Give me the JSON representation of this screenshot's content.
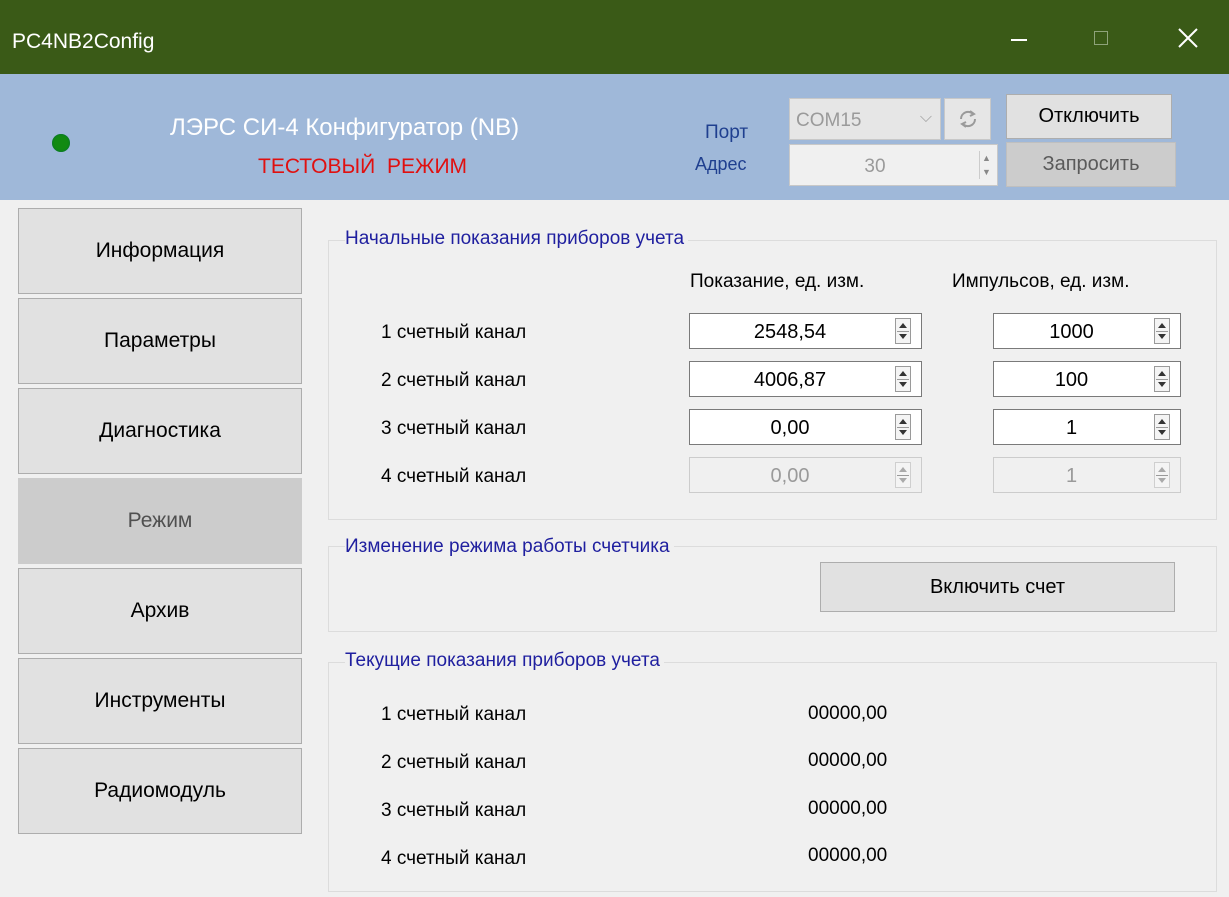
{
  "window": {
    "title": "PC4NB2Config"
  },
  "header": {
    "app_title": "ЛЭРС СИ-4 Конфигуратор (NB)",
    "mode_text": "ТЕСТОВЫЙ  РЕЖИМ",
    "port_label": "Порт",
    "port_value": "COM15",
    "address_label": "Адрес",
    "address_value": "30",
    "disconnect_label": "Отключить",
    "request_label": "Запросить",
    "status_color": "#118a11"
  },
  "sidebar": {
    "items": [
      {
        "label": "Информация",
        "active": false
      },
      {
        "label": "Параметры",
        "active": false
      },
      {
        "label": "Диагностика",
        "active": false
      },
      {
        "label": "Режим",
        "active": true
      },
      {
        "label": "Архив",
        "active": false
      },
      {
        "label": "Инструменты",
        "active": false
      },
      {
        "label": "Радиомодуль",
        "active": false
      }
    ]
  },
  "initial_readings": {
    "title": "Начальные показания приборов учета",
    "col_reading": "Показание, ед. изм.",
    "col_pulses": "Импульсов, ед. изм.",
    "rows": [
      {
        "label": "1 счетный канал",
        "reading": "2548,54",
        "pulses": "1000",
        "enabled": true
      },
      {
        "label": "2 счетный канал",
        "reading": "4006,87",
        "pulses": "100",
        "enabled": true
      },
      {
        "label": "3 счетный канал",
        "reading": "0,00",
        "pulses": "1",
        "enabled": true
      },
      {
        "label": "4 счетный канал",
        "reading": "0,00",
        "pulses": "1",
        "enabled": false
      }
    ]
  },
  "mode_change": {
    "title": "Изменение режима работы счетчика",
    "button_label": "Включить счет"
  },
  "current_readings": {
    "title": "Текущие показания приборов учета",
    "rows": [
      {
        "label": "1 счетный канал",
        "value": "00000,00"
      },
      {
        "label": "2 счетный канал",
        "value": "00000,00"
      },
      {
        "label": "3 счетный канал",
        "value": "00000,00"
      },
      {
        "label": "4 счетный канал",
        "value": "00000,00"
      }
    ]
  }
}
